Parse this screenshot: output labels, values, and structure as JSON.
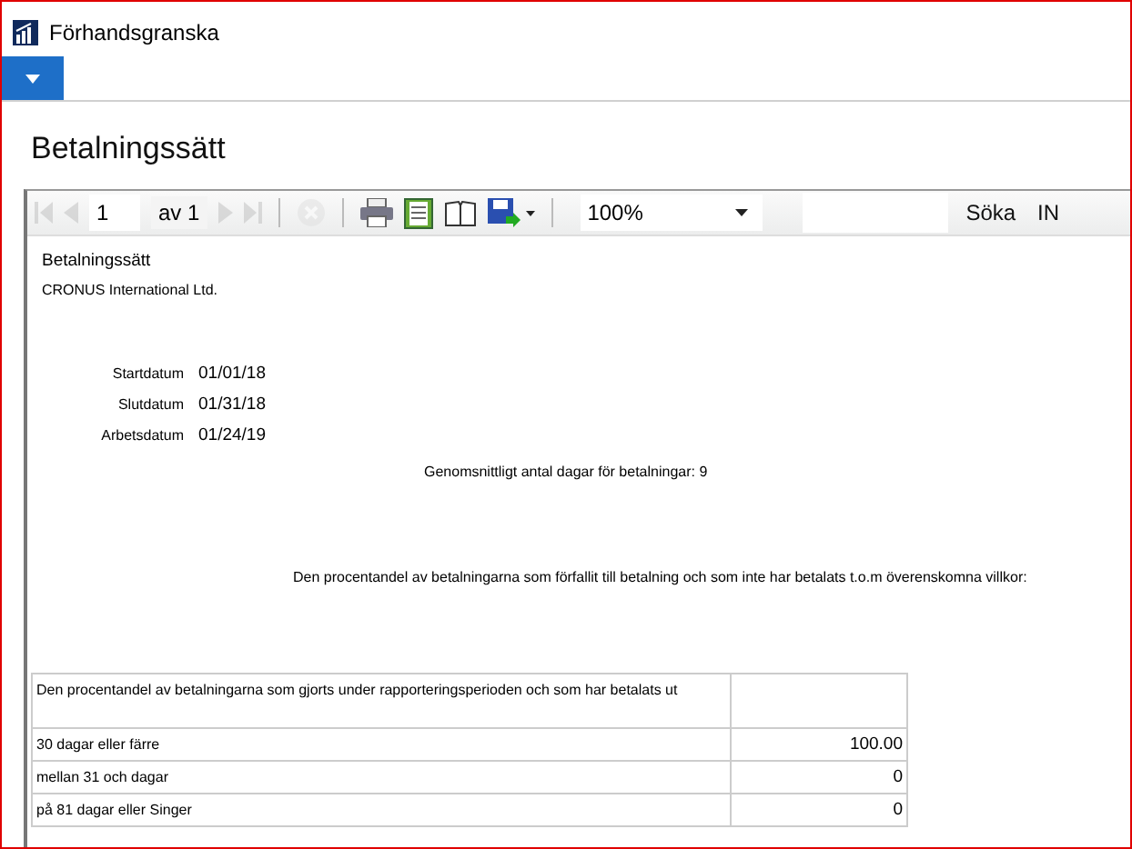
{
  "window": {
    "title": "Förhandsgranska"
  },
  "page_title": "Betalningssätt",
  "toolbar": {
    "buttons": [
      {
        "kind": "first",
        "disabled": true
      },
      {
        "kind": "prev",
        "disabled": true
      },
      {
        "kind": "page",
        "value": "1"
      },
      {
        "kind": "of",
        "text": "av 1"
      },
      {
        "kind": "next",
        "disabled": true
      },
      {
        "kind": "last",
        "disabled": true
      },
      {
        "kind": "sep"
      },
      {
        "kind": "stop",
        "disabled": true
      },
      {
        "kind": "sep"
      },
      {
        "kind": "print",
        "disabled": false
      },
      {
        "kind": "layout",
        "disabled": false
      },
      {
        "kind": "setup",
        "disabled": false
      },
      {
        "kind": "export",
        "disabled": false
      },
      {
        "kind": "sep"
      }
    ],
    "zoom": "100%",
    "find_label": "Söka",
    "next_label": "IN"
  },
  "report": {
    "title": "Betalningssätt",
    "company": "CRONUS International Ltd.",
    "dates": [
      {
        "label": "Startdatum",
        "value": "01/01/18"
      },
      {
        "label": "Slutdatum",
        "value": "01/31/18"
      },
      {
        "label": "Arbetsdatum",
        "value": "01/24/19"
      }
    ],
    "average": "Genomsnittligt antal dagar för betalningar: 9",
    "overdue": "Den procentandel av betalningarna som förfallit till betalning och som inte har betalats t.o.m överenskomna villkor:",
    "table": {
      "header": "Den procentandel av betalningarna som gjorts under rapporteringsperioden och som har betalats ut",
      "rows": [
        {
          "label": "30 dagar eller färre",
          "value": "100.00"
        },
        {
          "label": "mellan 31 och dagar",
          "value": "0"
        },
        {
          "label": "på 81 dagar eller Singer",
          "value": "0"
        }
      ]
    }
  }
}
